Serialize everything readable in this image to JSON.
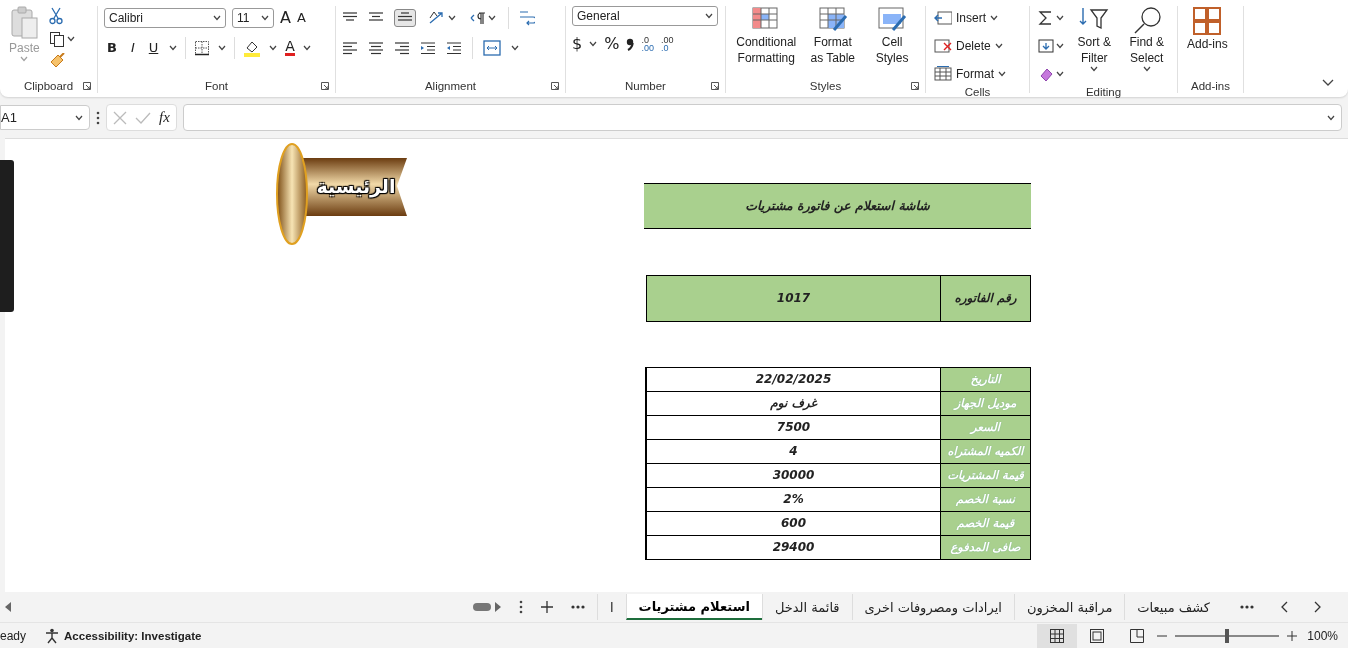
{
  "ribbon": {
    "clipboard": {
      "label": "Clipboard",
      "paste_label": "Paste",
      "paste_disabled": true
    },
    "font": {
      "label": "Font",
      "font_name": "Calibri",
      "font_size": "11",
      "grow": "A",
      "shrink": "A",
      "bold": "B",
      "italic": "I",
      "underline": "U",
      "font_color": "A"
    },
    "alignment": {
      "label": "Alignment"
    },
    "number": {
      "label": "Number",
      "format": "General",
      "currency": "$",
      "percent": "%",
      "increase_decimal": {
        "top": ".0",
        "bottom": ".00"
      },
      "decrease_decimal": {
        "top": ".00",
        "bottom": ".0"
      }
    },
    "styles": {
      "label": "Styles",
      "conditional_formatting": "Conditional Formatting",
      "format_as_table": "Format as Table",
      "cell_styles": "Cell Styles"
    },
    "cells": {
      "label": "Cells",
      "buttons": [
        "Insert",
        "Delete",
        "Format"
      ]
    },
    "editing": {
      "label": "Editing",
      "sort_filter": "Sort & Filter",
      "find_select": "Find & Select"
    },
    "addins": {
      "label": "Add-ins",
      "buttons": [
        "Add-ins"
      ]
    }
  },
  "formula_bar": {
    "name_box": "A1",
    "function_label": "fx"
  },
  "sheet": {
    "home_button": "الرئيسية",
    "title": "شاشة استعلام عن فاتورة مشتريات",
    "invoice": {
      "label": "رقم الفاتوره",
      "value": "1017"
    },
    "details": [
      {
        "label": "التاريخ",
        "value": "22/02/2025"
      },
      {
        "label": "موديل الجهاز",
        "value": "غرف نوم"
      },
      {
        "label": "السعر",
        "value": "7500"
      },
      {
        "label": "الكميه المشتراه",
        "value": "4"
      },
      {
        "label": "قيمة المشتريات",
        "value": "30000"
      },
      {
        "label": "نسبة الخصم",
        "value": "2%"
      },
      {
        "label": "قيمة الخصم",
        "value": "600"
      },
      {
        "label": "صافى المدفوع",
        "value": "29400"
      }
    ]
  },
  "sheet_tabs": [
    {
      "label": "كشف مبيعات",
      "selected": false
    },
    {
      "label": "مراقبة المخزون",
      "selected": false
    },
    {
      "label": "ايرادات ومصروفات اخرى",
      "selected": false
    },
    {
      "label": "قائمة الدخل",
      "selected": false
    },
    {
      "label": "استعلام مشتريات",
      "selected": true
    },
    {
      "label": "ا",
      "selected": false
    }
  ],
  "status_bar": {
    "mode": "eady",
    "accessibility": "Accessibility: Investigate",
    "zoom": "100%",
    "zoom_slider": {
      "level": 0.5
    }
  }
}
